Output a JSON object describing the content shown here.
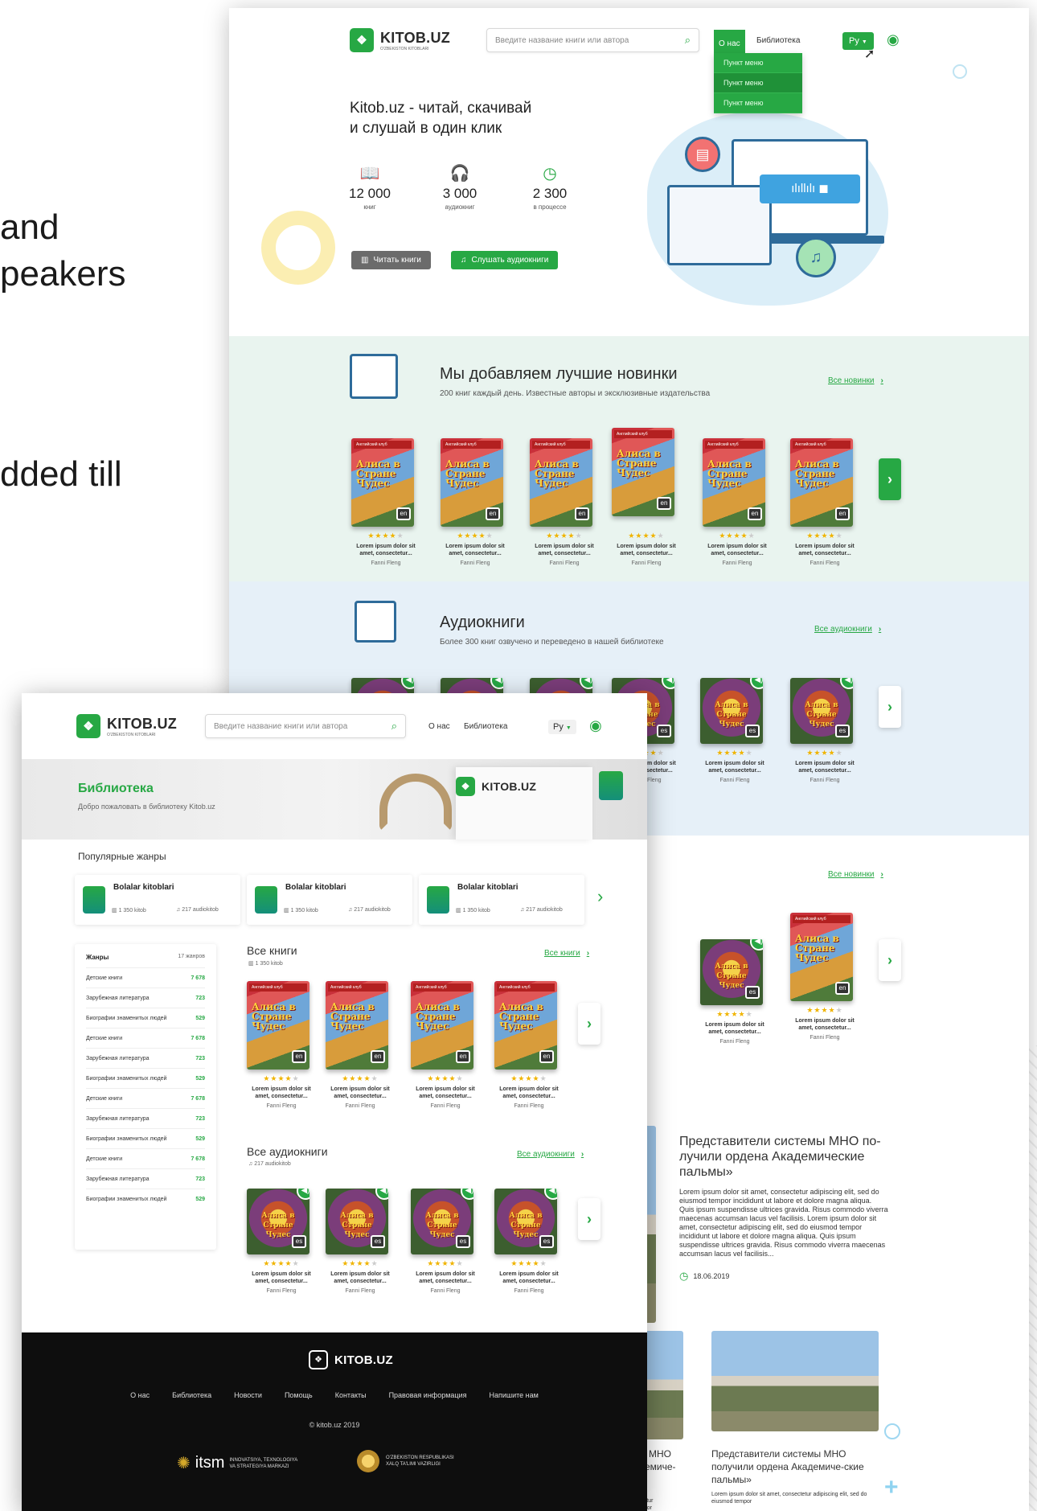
{
  "background": {
    "line1": "and",
    "line2": "peakers",
    "line3": "dded till"
  },
  "colors": {
    "accent": "#27a844",
    "green_section": "#e9f4ef",
    "blue_section": "#e6f0f8",
    "footer": "#0e0e0e"
  },
  "header": {
    "logo": "KITOB.UZ",
    "logo_sub": "O'ZBEKISTON KITOBLARI",
    "search_placeholder": "Введите название книги или автора",
    "nav_about": "О нас",
    "nav_library": "Библиотека",
    "lang": "Ру",
    "dropdown": [
      "Пункт меню",
      "Пункт меню",
      "Пункт меню"
    ]
  },
  "hero": {
    "title_line1": "Kitob.uz - читай, скачивай",
    "title_line2": "и слушай в один клик",
    "stats": [
      {
        "icon": "book-icon",
        "value": "12 000",
        "label": "книг"
      },
      {
        "icon": "headphones-icon",
        "value": "3 000",
        "label": "аудиокниг"
      },
      {
        "icon": "clock-icon",
        "value": "2 300",
        "label": "в процессе"
      }
    ],
    "btn_read": "Читать книги",
    "btn_listen": "Слушать аудиокниги"
  },
  "new_books": {
    "title": "Мы добавляем лучшие новинки",
    "subtitle": "200 книг каждый день. Известные авторы и эксклюзивные издательства",
    "link": "Все новинки"
  },
  "audiobooks": {
    "title": "Аудиокниги",
    "subtitle": "Более 300 книг озвучено и переведено в нашей библиотеке",
    "link": "Все аудиокниги"
  },
  "book": {
    "cover_tag": "Английский клуб",
    "cover_title": "Алиса в Стране Чудес",
    "lang_badge": "en",
    "lang_badge_audio": "es",
    "title": "Lorem ipsum dolor sit amet, consectetur...",
    "author": "Fanni Fleng"
  },
  "back_more": {
    "link": "Все новинки"
  },
  "news": {
    "main_title": "Представители системы МНО по-лучили ордена Академические пальмы»",
    "main_body": "Lorem ipsum dolor sit amet, consectetur adipiscing elit, sed do eiusmod tempor incididunt ut labore et dolore magna aliqua. Quis ipsum suspendisse ultrices gravida. Risus commodo viverra maecenas accumsan lacus vel facilisis. Lorem ipsum dolor sit amet, consectetur adipiscing elit, sed do eiusmod tempor incididunt ut labore et dolore magna aliqua. Quis ipsum suspendisse ultrices gravida. Risus commodo viverra maecenas accumsan lacus vel facilisis...",
    "date": "18.06.2019",
    "small_title": "Представители системы МНО получили ордена Академиче-ские пальмы»",
    "small_body": "Lorem ipsum dolor sit amet, consectetur adipiscing elit, sed do eiusmod tempor",
    "cut_title_a": "ы МНО",
    "cut_title_b": "демиче-",
    "cut_body_a": "ctetur",
    "cut_body_b": "mpor"
  },
  "library": {
    "banner_title": "Библиотека",
    "banner_sub": "Добро пожаловать в библиотеку Kitob.uz",
    "popular": "Популярные жанры",
    "genre_cards": [
      {
        "name": "Bolalar kitoblari",
        "books": "1 350 kitob",
        "audio": "217 audiokitob"
      },
      {
        "name": "Bolalar kitoblari",
        "books": "1 350 kitob",
        "audio": "217 audiokitob"
      },
      {
        "name": "Bolalar kitoblari",
        "books": "1 350 kitob",
        "audio": "217 audiokitob"
      }
    ],
    "sidebar_title": "Жанры",
    "sidebar_count": "17 жанров",
    "sidebar_rows": [
      {
        "name": "Детские книги",
        "count": "7 678"
      },
      {
        "name": "Зарубежная литература",
        "count": "723"
      },
      {
        "name": "Биографии знаменитых людей",
        "count": "529"
      },
      {
        "name": "Детские книги",
        "count": "7 678"
      },
      {
        "name": "Зарубежная литература",
        "count": "723"
      },
      {
        "name": "Биографии знаменитых людей",
        "count": "529"
      },
      {
        "name": "Детские книги",
        "count": "7 678"
      },
      {
        "name": "Зарубежная литература",
        "count": "723"
      },
      {
        "name": "Биографии знаменитых людей",
        "count": "529"
      },
      {
        "name": "Детские книги",
        "count": "7 678"
      },
      {
        "name": "Зарубежная литература",
        "count": "723"
      },
      {
        "name": "Биографии знаменитых людей",
        "count": "529"
      }
    ],
    "all_books": "Все книги",
    "all_books_count": "1 350 kitob",
    "all_books_link": "Все книги",
    "all_audio": "Все аудиокниги",
    "all_audio_count": "217 audiokitob",
    "all_audio_link": "Все аудиокниги"
  },
  "footer": {
    "logo": "KITOB.UZ",
    "links": [
      "О нас",
      "Библиотека",
      "Новости",
      "Помощь",
      "Контакты",
      "Правовая информация",
      "Напишите нам"
    ],
    "copyright": "© kitob.uz 2019",
    "itsm": "itsm",
    "itsm_sub1": "INNOVATSIYA, TEXNOLOGIYA",
    "itsm_sub2": "VA STRATEGIYA MARKAZI",
    "ministry1": "O'ZBEKISTON RESPUBLIKASI",
    "ministry2": "XALQ TA'LIMI VAZIRLIGI"
  }
}
